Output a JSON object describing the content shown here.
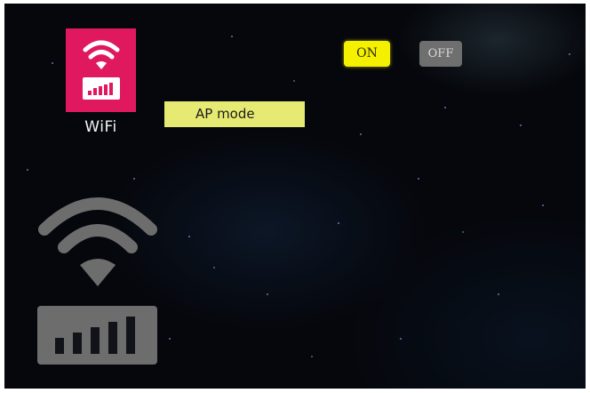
{
  "wifi_tile": {
    "label": "WiFi",
    "icon": "wifi-signal-icon",
    "color": "#e0195f"
  },
  "ap_mode": {
    "label": "AP mode",
    "color": "#e7ea72"
  },
  "toggles": {
    "on_label": "ON",
    "off_label": "OFF",
    "selected": "ON",
    "on_color": "#f4f000",
    "off_color": "#6f6f6f"
  },
  "preview": {
    "icon": "wifi-signal-icon",
    "color": "#6d6d6d"
  }
}
